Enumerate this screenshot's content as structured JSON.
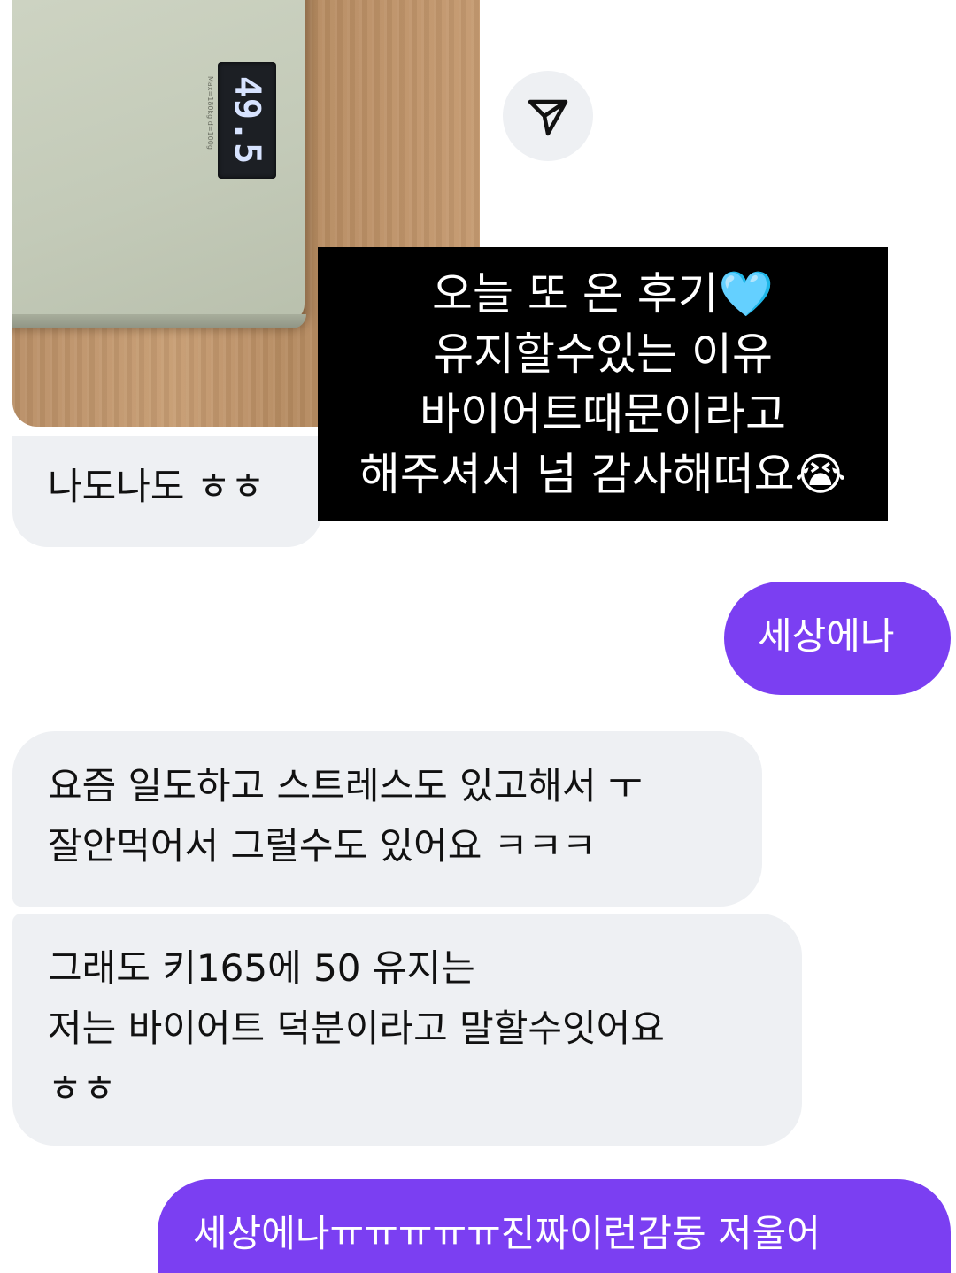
{
  "photo": {
    "scale_reading": "49.5",
    "scale_unit": "KG",
    "scale_spec": "Max=180kg  d=100g"
  },
  "caption": {
    "lines": [
      "오늘 또 온 후기🩵",
      "유지할수있는 이유",
      "바이어트때문이라고",
      "해주셔서 넘 감사해떠요😭"
    ]
  },
  "messages": [
    {
      "sender": "them",
      "lines": [
        "나도나도 ㅎㅎ"
      ]
    },
    {
      "sender": "me",
      "lines": [
        "세상에나"
      ]
    },
    {
      "sender": "them",
      "lines": [
        "요즘 일도하고 스트레스도 있고해서 ㅜ",
        "잘안먹어서 그럴수도 있어요 ㅋㅋㅋ"
      ]
    },
    {
      "sender": "them",
      "lines": [
        "그래도 키165에 50 유지는",
        "저는 바이어트 덕분이라고 말할수잇어요",
        "ㅎㅎ"
      ]
    },
    {
      "sender": "me",
      "lines": [
        "세상에나ㅠㅠㅠㅠㅠ진짜이런감동 저울어"
      ]
    }
  ],
  "colors": {
    "incoming_bubble": "#eef0f3",
    "outgoing_bubble": "#7b3ff2",
    "caption_bg": "#000000"
  },
  "icons": {
    "share": "send-icon"
  }
}
